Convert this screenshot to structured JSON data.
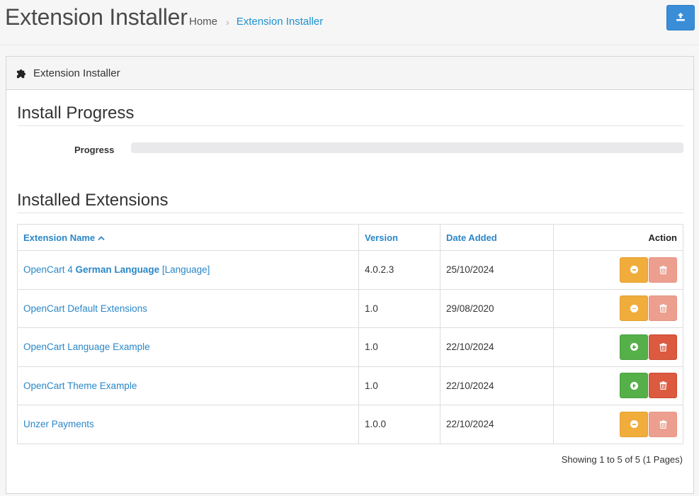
{
  "header": {
    "title": "Extension Installer",
    "breadcrumb": {
      "home": "Home",
      "current": "Extension Installer"
    },
    "upload_icon": "upload-icon"
  },
  "panel": {
    "icon": "puzzle-icon",
    "title": "Extension Installer"
  },
  "install": {
    "section_title": "Install Progress",
    "progress_label": "Progress",
    "progress_value": 0
  },
  "installed": {
    "section_title": "Installed Extensions",
    "columns": {
      "name": "Extension Name",
      "sort_icon": "chevron-up-icon",
      "version": "Version",
      "date": "Date Added",
      "action": "Action"
    },
    "rows": [
      {
        "name_prefix": "OpenCart 4 ",
        "name_bold": "German Language",
        "name_suffix": " [Language]",
        "version": "4.0.2.3",
        "date": "25/10/2024",
        "installed": true
      },
      {
        "name_prefix": "OpenCart Default Extensions",
        "name_bold": "",
        "name_suffix": "",
        "version": "1.0",
        "date": "29/08/2020",
        "installed": true
      },
      {
        "name_prefix": "OpenCart Language Example",
        "name_bold": "",
        "name_suffix": "",
        "version": "1.0",
        "date": "22/10/2024",
        "installed": false
      },
      {
        "name_prefix": "OpenCart Theme Example",
        "name_bold": "",
        "name_suffix": "",
        "version": "1.0",
        "date": "22/10/2024",
        "installed": false
      },
      {
        "name_prefix": "Unzer Payments",
        "name_bold": "",
        "name_suffix": "",
        "version": "1.0.0",
        "date": "22/10/2024",
        "installed": true
      }
    ],
    "results": "Showing 1 to 5 of 5 (1 Pages)"
  },
  "colors": {
    "link": "#2a87c8",
    "primary": "#3a8ed8",
    "warning": "#f0ad3c",
    "success": "#56b04a",
    "danger": "#dc5a3f"
  }
}
